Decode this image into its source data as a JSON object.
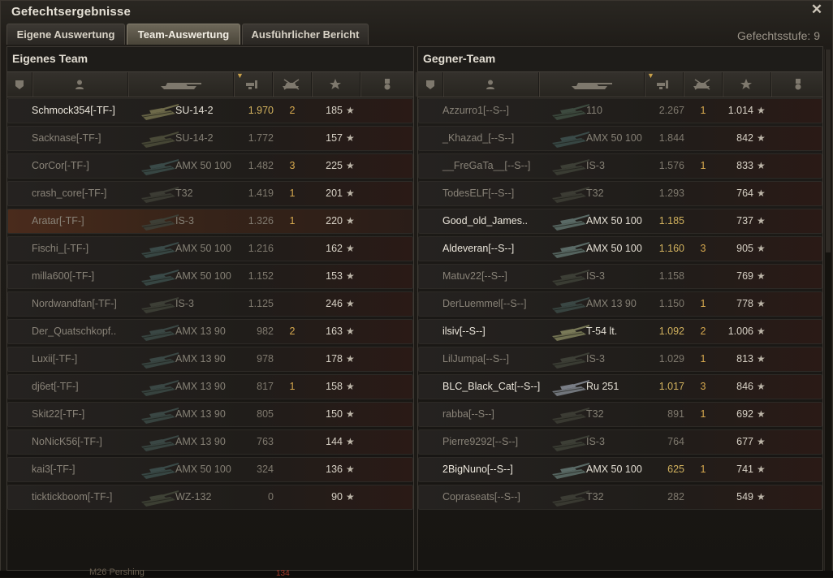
{
  "window": {
    "title": "Gefechtsergebnisse",
    "close_glyph": "✕",
    "stage": "Gefechtsstufe: 9"
  },
  "tabs": [
    {
      "label": "Eigene Auswertung",
      "active": false
    },
    {
      "label": "Team-Auswertung",
      "active": true
    },
    {
      "label": "Ausführlicher Bericht",
      "active": false
    }
  ],
  "header_icons": [
    "vehicle-class-icon",
    "player-icon",
    "tank-icon",
    "experience-icon",
    "kills-icon",
    "damage-star-icon",
    "medal-icon"
  ],
  "own_team": {
    "title": "Eigenes Team",
    "players": [
      {
        "name": "Schmock354[-TF-]",
        "tank": "SU-14-2",
        "xp": "1.970",
        "kills": "2",
        "dmg": "185",
        "state": "alive",
        "hl": true,
        "tank_color": "#6e6a4a"
      },
      {
        "name": "Sacknase[-TF-]",
        "tank": "SU-14-2",
        "xp": "1.772",
        "kills": "",
        "dmg": "157",
        "state": "dead",
        "hl": false,
        "tank_color": "#4a4a38"
      },
      {
        "name": "CorCor[-TF-]",
        "tank": "AMX 50 100",
        "xp": "1.482",
        "kills": "3",
        "dmg": "225",
        "state": "dead",
        "hl": false,
        "tank_color": "#3a4a48"
      },
      {
        "name": "crash_core[-TF-]",
        "tank": "T32",
        "xp": "1.419",
        "kills": "1",
        "dmg": "201",
        "state": "dead",
        "hl": false,
        "tank_color": "#3c3c34"
      },
      {
        "name": "Aratar[-TF-]",
        "tank": "IS-3",
        "xp": "1.326",
        "kills": "1",
        "dmg": "220",
        "state": "self",
        "hl": false,
        "tank_color": "#3d3f36"
      },
      {
        "name": "Fischi_[-TF-]",
        "tank": "AMX 50 100",
        "xp": "1.216",
        "kills": "",
        "dmg": "162",
        "state": "dead",
        "hl": false,
        "tank_color": "#3a4a48"
      },
      {
        "name": "milla600[-TF-]",
        "tank": "AMX 50 100",
        "xp": "1.152",
        "kills": "",
        "dmg": "153",
        "state": "dead",
        "hl": false,
        "tank_color": "#3a4a48"
      },
      {
        "name": "Nordwandfan[-TF-]",
        "tank": "IS-3",
        "xp": "1.125",
        "kills": "",
        "dmg": "246",
        "state": "dead",
        "hl": false,
        "tank_color": "#3d3f36"
      },
      {
        "name": "Der_Quatschkopf..",
        "tank": "AMX 13 90",
        "xp": "982",
        "kills": "2",
        "dmg": "163",
        "state": "dead",
        "hl": false,
        "tank_color": "#3a4744"
      },
      {
        "name": "Luxii[-TF-]",
        "tank": "AMX 13 90",
        "xp": "978",
        "kills": "",
        "dmg": "178",
        "state": "dead",
        "hl": false,
        "tank_color": "#3a4744"
      },
      {
        "name": "dj6et[-TF-]",
        "tank": "AMX 13 90",
        "xp": "817",
        "kills": "1",
        "dmg": "158",
        "state": "dead",
        "hl": false,
        "tank_color": "#3a4744"
      },
      {
        "name": "Skit22[-TF-]",
        "tank": "AMX 13 90",
        "xp": "805",
        "kills": "",
        "dmg": "150",
        "state": "dead",
        "hl": false,
        "tank_color": "#3a4744"
      },
      {
        "name": "NoNicK56[-TF-]",
        "tank": "AMX 13 90",
        "xp": "763",
        "kills": "",
        "dmg": "144",
        "state": "dead",
        "hl": false,
        "tank_color": "#3a4744"
      },
      {
        "name": "kai3[-TF-]",
        "tank": "AMX 50 100",
        "xp": "324",
        "kills": "",
        "dmg": "136",
        "state": "dead",
        "hl": false,
        "tank_color": "#3a4a48"
      },
      {
        "name": "ticktickboom[-TF-]",
        "tank": "WZ-132",
        "xp": "0",
        "kills": "",
        "dmg": "90",
        "state": "dead",
        "hl": false,
        "tank_color": "#3f4236"
      }
    ]
  },
  "enemy_team": {
    "title": "Gegner-Team",
    "players": [
      {
        "name": "Azzurro1[--S--]",
        "tank": "110",
        "xp": "2.267",
        "kills": "1",
        "dmg": "1.014",
        "state": "dead",
        "hl": false,
        "tank_color": "#3d4a3f"
      },
      {
        "name": "_Khazad_[--S--]",
        "tank": "AMX 50 100",
        "xp": "1.844",
        "kills": "",
        "dmg": "842",
        "state": "dead",
        "hl": false,
        "tank_color": "#3a4a48"
      },
      {
        "name": "__FreGaTa__[--S--]",
        "tank": "IS-3",
        "xp": "1.576",
        "kills": "1",
        "dmg": "833",
        "state": "dead",
        "hl": false,
        "tank_color": "#3d3f36"
      },
      {
        "name": "TodesELF[--S--]",
        "tank": "T32",
        "xp": "1.293",
        "kills": "",
        "dmg": "764",
        "state": "dead",
        "hl": false,
        "tank_color": "#3c3c34"
      },
      {
        "name": "Good_old_James..",
        "tank": "AMX 50 100",
        "xp": "1.185",
        "kills": "",
        "dmg": "737",
        "state": "alive",
        "hl": true,
        "tank_color": "#5a6a66"
      },
      {
        "name": "Aldeveran[--S--]",
        "tank": "AMX 50 100",
        "xp": "1.160",
        "kills": "3",
        "dmg": "905",
        "state": "alive",
        "hl": true,
        "tank_color": "#5a6a66"
      },
      {
        "name": "Matuv22[--S--]",
        "tank": "IS-3",
        "xp": "1.158",
        "kills": "",
        "dmg": "769",
        "state": "dead",
        "hl": false,
        "tank_color": "#3d3f36"
      },
      {
        "name": "DerLuemmel[--S--]",
        "tank": "AMX 13 90",
        "xp": "1.150",
        "kills": "1",
        "dmg": "778",
        "state": "dead",
        "hl": false,
        "tank_color": "#3a4744"
      },
      {
        "name": "ilsiv[--S--]",
        "tank": "T-54 lt.",
        "xp": "1.092",
        "kills": "2",
        "dmg": "1.006",
        "state": "alive",
        "hl": true,
        "tank_color": "#7a7a58"
      },
      {
        "name": "LilJumpa[--S--]",
        "tank": "IS-3",
        "xp": "1.029",
        "kills": "1",
        "dmg": "813",
        "state": "dead",
        "hl": false,
        "tank_color": "#3d3f36"
      },
      {
        "name": "BLC_Black_Cat[--S--]",
        "tank": "Ru 251",
        "xp": "1.017",
        "kills": "3",
        "dmg": "846",
        "state": "alive",
        "hl": true,
        "tank_color": "#7a7e86"
      },
      {
        "name": "rabba[--S--]",
        "tank": "T32",
        "xp": "891",
        "kills": "1",
        "dmg": "692",
        "state": "dead",
        "hl": false,
        "tank_color": "#3c3c34"
      },
      {
        "name": "Pierre9292[--S--]",
        "tank": "IS-3",
        "xp": "764",
        "kills": "",
        "dmg": "677",
        "state": "dead",
        "hl": false,
        "tank_color": "#3d3f36"
      },
      {
        "name": "2BigNuno[--S--]",
        "tank": "AMX 50 100",
        "xp": "625",
        "kills": "1",
        "dmg": "741",
        "state": "alive",
        "hl": true,
        "tank_color": "#5a6a66"
      },
      {
        "name": "Copraseats[--S--]",
        "tank": "T32",
        "xp": "282",
        "kills": "",
        "dmg": "549",
        "state": "dead",
        "hl": false,
        "tank_color": "#3c3c34"
      }
    ]
  },
  "footer": {
    "tank_text": "M26 Pershing",
    "badge": "134"
  }
}
